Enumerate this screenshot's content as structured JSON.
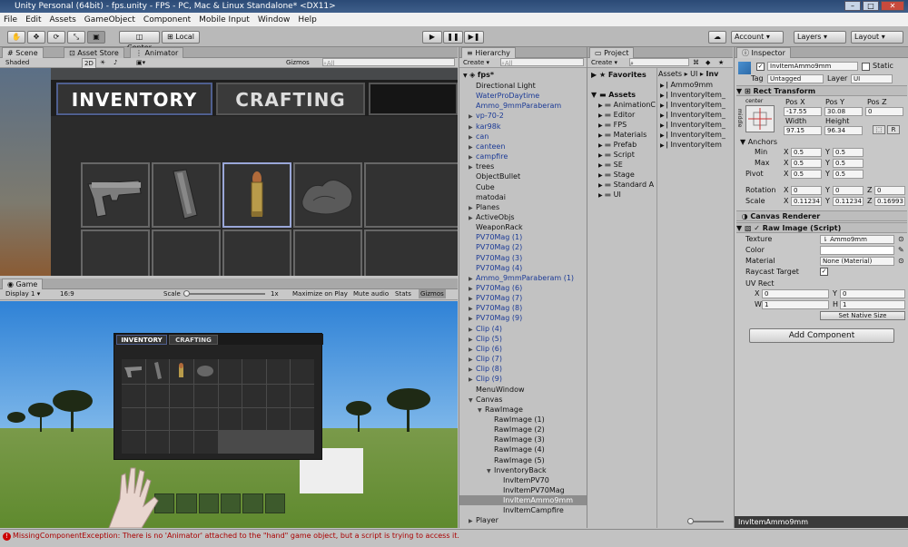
{
  "window": {
    "title": "Unity Personal (64bit) - fps.unity - FPS - PC, Mac & Linux Standalone* <DX11>"
  },
  "menu": [
    "File",
    "Edit",
    "Assets",
    "GameObject",
    "Component",
    "Mobile Input",
    "Window",
    "Help"
  ],
  "toolbar": {
    "pivot": "Center",
    "space": "Local",
    "account": "Account",
    "layers": "Layers",
    "layout": "Layout"
  },
  "scene": {
    "tabs": [
      "Scene",
      "Asset Store",
      "Animator"
    ],
    "shading": "Shaded",
    "mode2d": "2D",
    "gizmos": "Gizmos",
    "search_placeholder": "All",
    "inventory_tab": "INVENTORY",
    "crafting_tab": "CRAFTING"
  },
  "game": {
    "tab": "Game",
    "display": "Display 1",
    "aspect": "16:9",
    "scale_label": "Scale",
    "scale_value": "1x",
    "maximize": "Maximize on Play",
    "mute": "Mute audio",
    "stats": "Stats",
    "gizmos": "Gizmos",
    "inventory_tab": "INVENTORY",
    "crafting_tab": "CRAFTING"
  },
  "hierarchy": {
    "tab": "Hierarchy",
    "create": "Create",
    "search_placeholder": "All",
    "scene": "fps*",
    "items": [
      {
        "label": "Directional Light",
        "indent": 1,
        "arrow": "",
        "blue": false
      },
      {
        "label": "WaterProDaytime",
        "indent": 1,
        "arrow": "",
        "blue": true
      },
      {
        "label": "Ammo_9mmParaberam",
        "indent": 1,
        "arrow": "",
        "blue": true
      },
      {
        "label": "vp-70-2",
        "indent": 1,
        "arrow": "▶",
        "blue": true
      },
      {
        "label": "kar98k",
        "indent": 1,
        "arrow": "▶",
        "blue": true
      },
      {
        "label": "can",
        "indent": 1,
        "arrow": "▶",
        "blue": true
      },
      {
        "label": "canteen",
        "indent": 1,
        "arrow": "▶",
        "blue": true
      },
      {
        "label": "campfire",
        "indent": 1,
        "arrow": "▶",
        "blue": true
      },
      {
        "label": "trees",
        "indent": 1,
        "arrow": "▶",
        "blue": false
      },
      {
        "label": "ObjectBullet",
        "indent": 1,
        "arrow": "",
        "blue": false
      },
      {
        "label": "Cube",
        "indent": 1,
        "arrow": "",
        "blue": false
      },
      {
        "label": "matodai",
        "indent": 1,
        "arrow": "",
        "blue": false
      },
      {
        "label": "Planes",
        "indent": 1,
        "arrow": "▶",
        "blue": false
      },
      {
        "label": "ActiveObjs",
        "indent": 1,
        "arrow": "▶",
        "blue": false
      },
      {
        "label": "WeaponRack",
        "indent": 1,
        "arrow": "",
        "blue": false
      },
      {
        "label": "PV70Mag (1)",
        "indent": 1,
        "arrow": "",
        "blue": true
      },
      {
        "label": "PV70Mag (2)",
        "indent": 1,
        "arrow": "",
        "blue": true
      },
      {
        "label": "PV70Mag (3)",
        "indent": 1,
        "arrow": "",
        "blue": true
      },
      {
        "label": "PV70Mag (4)",
        "indent": 1,
        "arrow": "",
        "blue": true
      },
      {
        "label": "Ammo_9mmParaberam (1)",
        "indent": 1,
        "arrow": "▶",
        "blue": true
      },
      {
        "label": "PV70Mag (6)",
        "indent": 1,
        "arrow": "▶",
        "blue": true
      },
      {
        "label": "PV70Mag (7)",
        "indent": 1,
        "arrow": "▶",
        "blue": true
      },
      {
        "label": "PV70Mag (8)",
        "indent": 1,
        "arrow": "▶",
        "blue": true
      },
      {
        "label": "PV70Mag (9)",
        "indent": 1,
        "arrow": "▶",
        "blue": true
      },
      {
        "label": "Clip (4)",
        "indent": 1,
        "arrow": "▶",
        "blue": true
      },
      {
        "label": "Clip (5)",
        "indent": 1,
        "arrow": "▶",
        "blue": true
      },
      {
        "label": "Clip (6)",
        "indent": 1,
        "arrow": "▶",
        "blue": true
      },
      {
        "label": "Clip (7)",
        "indent": 1,
        "arrow": "▶",
        "blue": true
      },
      {
        "label": "Clip (8)",
        "indent": 1,
        "arrow": "▶",
        "blue": true
      },
      {
        "label": "Clip (9)",
        "indent": 1,
        "arrow": "▶",
        "blue": true
      },
      {
        "label": "MenuWindow",
        "indent": 1,
        "arrow": "",
        "blue": false
      },
      {
        "label": "Canvas",
        "indent": 1,
        "arrow": "▼",
        "blue": false
      },
      {
        "label": "RawImage",
        "indent": 2,
        "arrow": "▼",
        "blue": false
      },
      {
        "label": "RawImage (1)",
        "indent": 3,
        "arrow": "",
        "blue": false
      },
      {
        "label": "RawImage (2)",
        "indent": 3,
        "arrow": "",
        "blue": false
      },
      {
        "label": "RawImage (3)",
        "indent": 3,
        "arrow": "",
        "blue": false
      },
      {
        "label": "RawImage (4)",
        "indent": 3,
        "arrow": "",
        "blue": false
      },
      {
        "label": "RawImage (5)",
        "indent": 3,
        "arrow": "",
        "blue": false
      },
      {
        "label": "InventoryBack",
        "indent": 3,
        "arrow": "▼",
        "blue": false
      },
      {
        "label": "InvItemPV70",
        "indent": 4,
        "arrow": "",
        "blue": false
      },
      {
        "label": "InvItemPV70Mag",
        "indent": 4,
        "arrow": "",
        "blue": false
      },
      {
        "label": "InvItemAmmo9mm",
        "indent": 4,
        "arrow": "",
        "blue": false,
        "selected": true
      },
      {
        "label": "InvItemCampfire",
        "indent": 4,
        "arrow": "",
        "blue": false
      },
      {
        "label": "Player",
        "indent": 1,
        "arrow": "▶",
        "blue": false
      }
    ]
  },
  "project": {
    "tab": "Project",
    "create": "Create",
    "favorites": "Favorites",
    "assets_root": "Assets",
    "breadcrumb": [
      "Assets",
      "UI",
      "Inv"
    ],
    "folders": [
      {
        "label": "AnimationC",
        "indent": 1
      },
      {
        "label": "Editor",
        "indent": 1
      },
      {
        "label": "FPS",
        "indent": 1
      },
      {
        "label": "Materials",
        "indent": 1
      },
      {
        "label": "Prefab",
        "indent": 1
      },
      {
        "label": "Script",
        "indent": 1
      },
      {
        "label": "SE",
        "indent": 1
      },
      {
        "label": "Stage",
        "indent": 1
      },
      {
        "label": "Standard A",
        "indent": 1
      },
      {
        "label": "UI",
        "indent": 1
      }
    ],
    "files": [
      "Ammo9mm",
      "InventoryItem_",
      "InventoryItem_",
      "InventoryItem_",
      "InventoryItem_",
      "InventoryItem_",
      "InventoryItem"
    ]
  },
  "inspector": {
    "tab": "Inspector",
    "object_name": "InvItemAmmo9mm",
    "static": "Static",
    "tag_label": "Tag",
    "tag_value": "Untagged",
    "layer_label": "Layer",
    "layer_value": "UI",
    "rect_transform": "Rect Transform",
    "anchor_left": "center",
    "anchor_side": "middle",
    "pos_x_label": "Pos X",
    "pos_y_label": "Pos Y",
    "pos_z_label": "Pos Z",
    "pos_x": "-17.55",
    "pos_y": "30.08",
    "pos_z": "0",
    "width_label": "Width",
    "height_label": "Height",
    "width": "97.15",
    "height": "96.34",
    "r_btn": "R",
    "anchors": "Anchors",
    "min": "Min",
    "max": "Max",
    "pivot": "Pivot",
    "min_x": "0.5",
    "min_y": "0.5",
    "max_x": "0.5",
    "max_y": "0.5",
    "pivot_x": "0.5",
    "pivot_y": "0.5",
    "rotation": "Rotation",
    "rot_x": "0",
    "rot_y": "0",
    "rot_z": "0",
    "scale": "Scale",
    "scale_x": "0.11234",
    "scale_y": "0.11234",
    "scale_z": "0.16993",
    "x": "X",
    "y": "Y",
    "z": "Z",
    "canvas_renderer": "Canvas Renderer",
    "raw_image": "Raw Image (Script)",
    "texture_label": "Texture",
    "texture_value": "Ammo9mm",
    "color_label": "Color",
    "material_label": "Material",
    "material_value": "None (Material)",
    "raycast_label": "Raycast Target",
    "uvrect_label": "UV Rect",
    "uv_x": "0",
    "uv_y": "0",
    "uv_w": "1",
    "uv_h": "1",
    "w": "W",
    "h": "H",
    "set_native": "Set Native Size",
    "add_component": "Add Component",
    "footer": "InvItemAmmo9mm"
  },
  "status": {
    "message": "MissingComponentException: There is no 'Animator' attached to the \"hand\" game object, but a script is trying to access it."
  }
}
